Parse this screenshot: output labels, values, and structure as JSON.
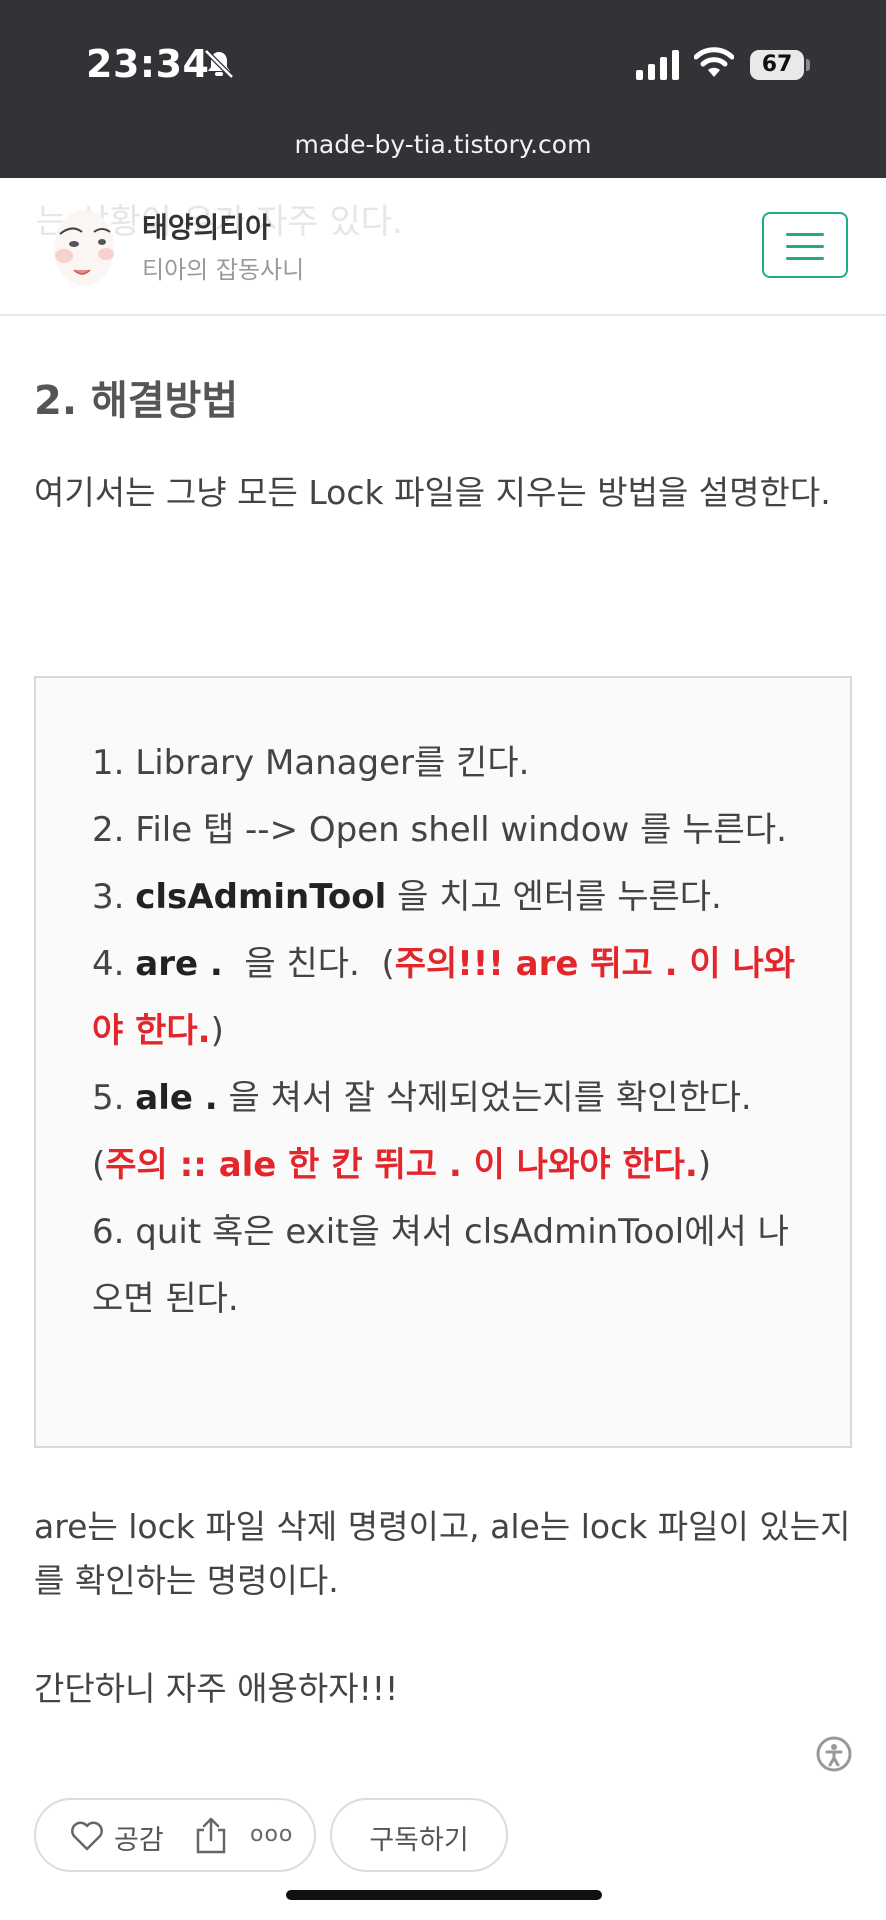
{
  "status_bar": {
    "time": "23:34",
    "battery": "67",
    "url": "made-by-tia.tistory.com",
    "icons": [
      "bell-slash-icon",
      "signal-icon",
      "wifi-icon",
      "battery-icon"
    ]
  },
  "header": {
    "blog_name": "태양의티아",
    "blog_subtitle": "티아의 잡동사니",
    "scrolled_text": "는 상황이 우가 자주 있다.",
    "menu_icon": "hamburger-icon"
  },
  "content": {
    "heading": "2. 해결방법",
    "intro": "여기서는 그냥 모든 Lock 파일을 지우는 방법을 설명한다.",
    "steps": {
      "s1": "1. Library Manager를 킨다.",
      "s2": "2. File 탭 --> Open shell window 를 누른다.",
      "s3_num": "3. ",
      "s3_cmd": "clsAdminTool",
      "s3_rest": " 을 치고 엔터를 누른다.",
      "s4_num": "4. ",
      "s4_cmd": "are .",
      "s4_mid": "  을 친다.  (",
      "s4_warn": "주의!!! are 뛰고 .  이 나와야 한다.",
      "s4_end": ")",
      "s5_num": "5. ",
      "s5_cmd": "ale .",
      "s5_rest": " 을 쳐서 잘 삭제되었는지를 확인한다.",
      "s5_open": "(",
      "s5_warn": "주의 :: ale 한 칸 뛰고 . 이 나와야 한다.",
      "s5_end": ")",
      "s6": "6. quit 혹은 exit을 쳐서 clsAdminTool에서 나오면 된다."
    },
    "explain": "are는 lock 파일 삭제 명령이고, ale는 lock 파일이 있는지를 확인하는 명령이다.",
    "closing": "간단하니 자주 애용하자!!!"
  },
  "actions": {
    "like_label": "공감",
    "subscribe_label": "구독하기",
    "more": "ooo",
    "icons": [
      "heart-icon",
      "share-icon",
      "more-icon",
      "accessibility-icon"
    ]
  },
  "colors": {
    "accent": "#21a98a",
    "warning": "#e3262b",
    "statusbar": "#313336"
  }
}
